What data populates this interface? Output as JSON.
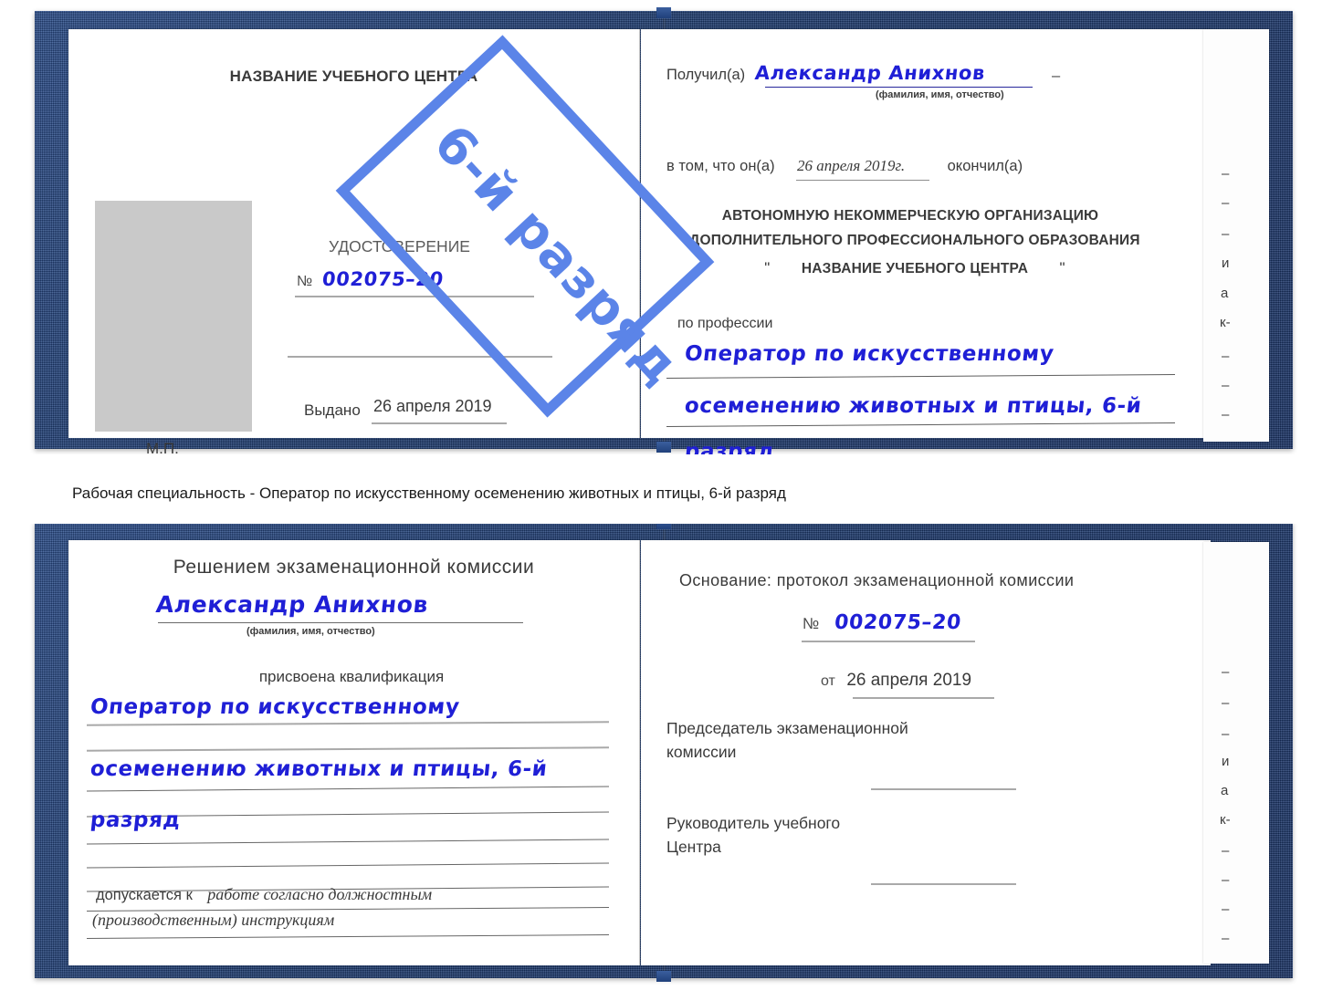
{
  "document": {
    "type": "certificate-scan",
    "caption": "Рабочая специальность - Оператор по искусственному осеменению животных и птицы, 6-й разряд"
  },
  "watermark": {
    "text": "6-й разряд",
    "color": "#5b84e8"
  },
  "colors": {
    "cover": "#1d3c73",
    "handwriting": "#1f1fd6",
    "typed_text": "#3a3a3a",
    "rule_line": "#a9a9a9",
    "photo_placeholder": "#c9c9c9"
  },
  "certificate_top": {
    "left_page": {
      "heading": "НАЗВАНИЕ УЧЕБНОГО ЦЕНТРА",
      "doc_type": "УДОСТОВЕРЕНИЕ",
      "number_label": "№",
      "number_value": "002075–20",
      "issued_label": "Выдано",
      "issued_value": "26 апреля 2019",
      "seal_label": "М.П.",
      "photo_placeholder": "photo-placeholder"
    },
    "right_page": {
      "received_label": "Получил(а)",
      "received_value": "Александр Анихнов",
      "received_hint": "(фамилия, имя, отчество)",
      "that_he_label": "в том, что он(а)",
      "that_he_date": "26 апреля 2019г.",
      "finished_label": "окончил(а)",
      "org_line1": "АВТОНОМНУЮ НЕКОММЕРЧЕСКУЮ ОРГАНИЗАЦИЮ",
      "org_line2": "ДОПОЛНИТЕЛЬНОГО ПРОФЕССИОНАЛЬНОГО ОБРАЗОВАНИЯ",
      "org_quote_open": "\"",
      "org_line3": "НАЗВАНИЕ УЧЕБНОГО ЦЕНТРА",
      "org_quote_close": "\"",
      "profession_label": "по профессии",
      "profession_line1": "Оператор по искусственному",
      "profession_line2": "осеменению животных и птицы, 6-й",
      "profession_line3": "разряд"
    },
    "edge_fragments": [
      "–",
      "–",
      "–",
      "и",
      "а",
      "к-",
      "–",
      "–",
      "–",
      "–"
    ]
  },
  "certificate_bottom": {
    "left_page": {
      "heading": "Решением экзаменационной комиссии",
      "name_value": "Александр Анихнов",
      "name_hint": "(фамилия, имя, отчество)",
      "qualification_label": "присвоена квалификация",
      "qualification_line1": "Оператор по искусственному",
      "qualification_line2": "осеменению животных и птицы, 6-й",
      "qualification_line3": "разряд",
      "admitted_label": "допускается к",
      "admitted_value_line1": "работе согласно должностным",
      "admitted_value_line2": "(производственным) инструкциям"
    },
    "right_page": {
      "basis_label": "Основание: протокол экзаменационной комиссии",
      "number_label": "№",
      "number_value": "002075–20",
      "date_label": "от",
      "date_value": "26 апреля 2019",
      "chairman_line1": "Председатель экзаменационной",
      "chairman_line2": "комиссии",
      "head_line1": "Руководитель учебного",
      "head_line2": "Центра"
    },
    "edge_fragments": [
      "–",
      "–",
      "–",
      "и",
      "а",
      "к-",
      "–",
      "–",
      "–",
      "–"
    ]
  }
}
